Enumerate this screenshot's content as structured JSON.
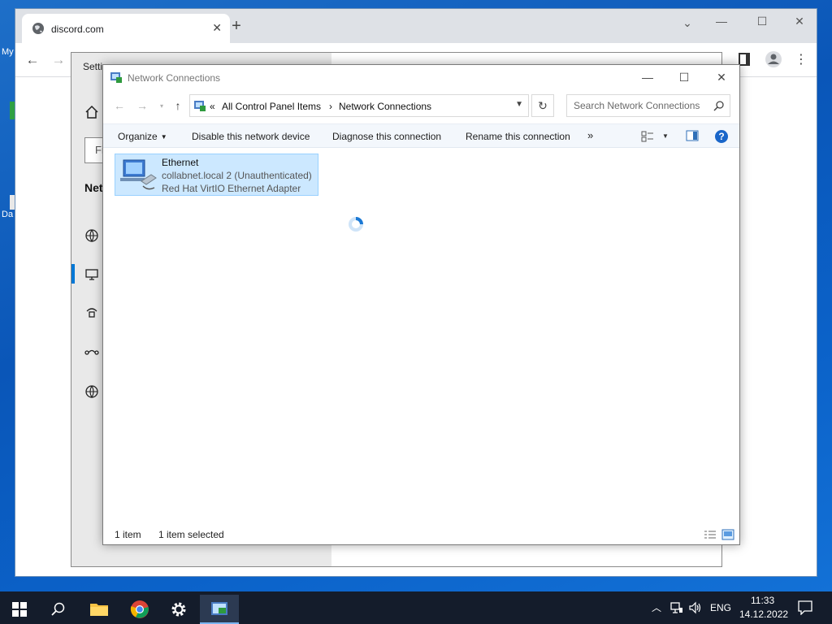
{
  "desktop": {
    "icon_label_1": "My",
    "icon_label_2": "Da"
  },
  "browser": {
    "tab_title": "discord.com",
    "new_tab": "+",
    "tab_close": "✕",
    "minimize": "—",
    "maximize": "☐",
    "close": "✕",
    "chevron": "⌄"
  },
  "settings": {
    "title": "Setti",
    "find_placeholder": "Fi",
    "heading": "Net"
  },
  "network": {
    "title": "Network Connections",
    "address": {
      "chevrons": "«",
      "crumb1": "All Control Panel Items",
      "separator": "›",
      "crumb2": "Network Connections"
    },
    "search_placeholder": "Search Network Connections",
    "commands": {
      "organize": "Organize",
      "disable": "Disable this network device",
      "diagnose": "Diagnose this connection",
      "rename": "Rename this connection",
      "more": "»"
    },
    "item": {
      "name": "Ethernet",
      "network": "collabnet.local 2 (Unauthenticated)",
      "adapter": "Red Hat VirtIO Ethernet Adapter",
      "icon": "network-adapter-icon"
    },
    "status": {
      "count": "1 item",
      "selected": "1 item selected"
    }
  },
  "taskbar": {
    "language": "ENG",
    "time": "11:33",
    "date": "14.12.2022"
  },
  "colors": {
    "desktop": "#0b62c9",
    "selection": "#cce8ff",
    "selection_border": "#99d1ff",
    "accent": "#0078d7",
    "taskbar": "#141c2b"
  }
}
